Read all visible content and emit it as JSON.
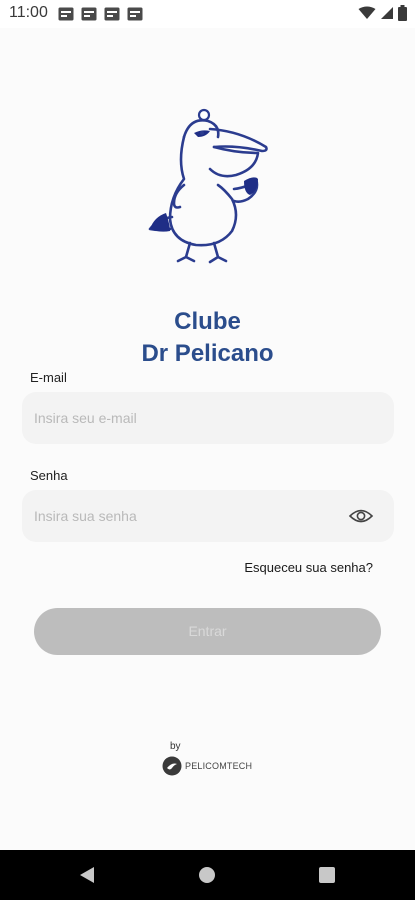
{
  "status_bar": {
    "time": "11:00",
    "notification_icons": [
      "notification-icon",
      "notification-icon",
      "notification-icon",
      "notification-icon"
    ],
    "right_icons": [
      "wifi-icon",
      "signal-icon",
      "battery-icon"
    ]
  },
  "app": {
    "title_line1": "Clube",
    "title_line2": "Dr Pelicano",
    "title_color": "#2b4d8c",
    "email_label": "E-mail",
    "email_placeholder": "Insira seu e-mail",
    "email_value": "",
    "password_label": "Senha",
    "password_placeholder": "Insira sua senha",
    "password_value": "",
    "forgot_link": "Esqueceu sua senha?",
    "login_button": "Entrar",
    "footer_by": "by",
    "footer_brand": "PELICOMTECH"
  },
  "nav_bar": {
    "buttons": [
      "back-icon",
      "home-icon",
      "recents-icon"
    ]
  }
}
